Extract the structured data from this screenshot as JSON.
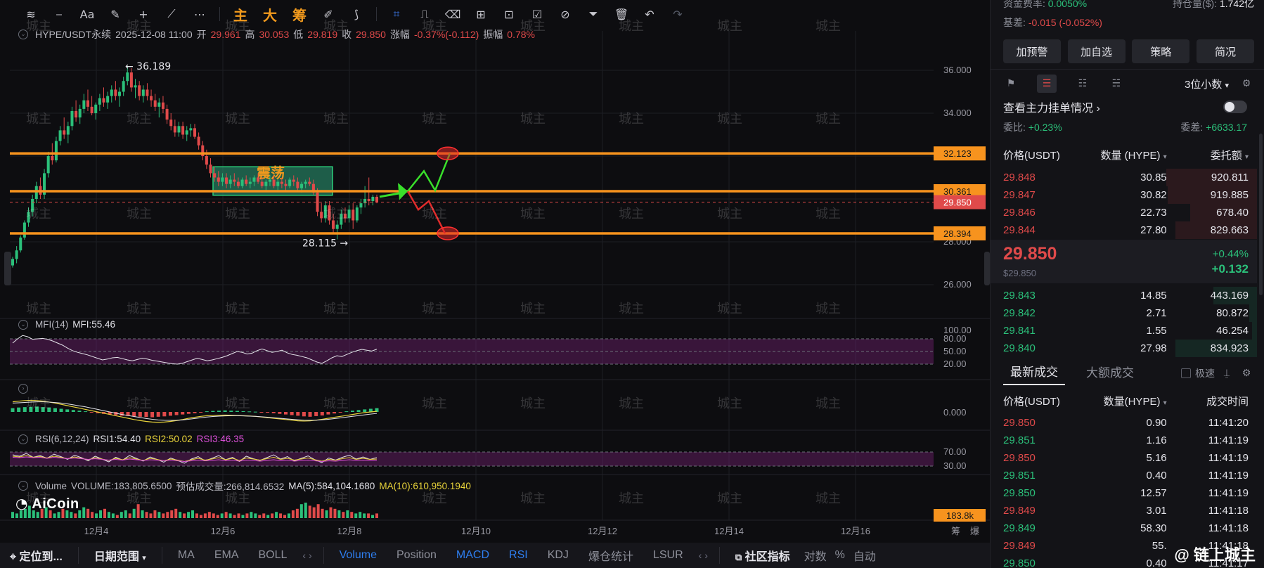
{
  "toolbar": {
    "cn_tools": [
      "主",
      "大",
      "筹"
    ]
  },
  "info": {
    "symbol": "HYPE/USDT永续",
    "datetime": "2025-12-08 11:00",
    "open_label": "开",
    "open": "29.961",
    "high_label": "高",
    "high": "30.053",
    "low_label": "低",
    "low": "29.819",
    "close_label": "收",
    "close": "29.850",
    "change_label": "涨幅",
    "change": "-0.37%(-0.112)",
    "amp_label": "振幅",
    "amp": "0.78%"
  },
  "chart_data": {
    "type": "candlestick",
    "price_axis": {
      "ticks": [
        "36.000",
        "34.000",
        "32.000",
        "30.000",
        "28.000",
        "26.000"
      ]
    },
    "x_ticks": [
      "12月4",
      "12月6",
      "12月8",
      "12月10",
      "12月12",
      "12月14",
      "12月16"
    ],
    "high_annotation": "36.189",
    "low_annotation": "28.115",
    "levels": [
      {
        "label": "32.123",
        "value": 32.123
      },
      {
        "label": "30.361",
        "value": 30.361
      },
      {
        "label": "28.394",
        "value": 28.394
      }
    ],
    "current_price": {
      "label": "29.850",
      "value": 29.85
    },
    "range_box_label": "震荡",
    "candles": [
      [
        26.9,
        27.3,
        26.8,
        27.2
      ],
      [
        27.2,
        27.8,
        27.0,
        27.6
      ],
      [
        27.6,
        28.3,
        27.5,
        28.2
      ],
      [
        28.2,
        29.0,
        28.1,
        28.9
      ],
      [
        28.9,
        29.6,
        28.7,
        29.4
      ],
      [
        29.4,
        30.2,
        29.2,
        30.0
      ],
      [
        30.0,
        30.8,
        29.8,
        30.6
      ],
      [
        30.6,
        31.0,
        30.0,
        30.2
      ],
      [
        30.2,
        31.4,
        30.0,
        31.2
      ],
      [
        31.2,
        32.2,
        31.0,
        32.0
      ],
      [
        32.0,
        32.6,
        31.6,
        31.8
      ],
      [
        31.8,
        32.9,
        31.7,
        32.7
      ],
      [
        32.7,
        33.4,
        32.5,
        33.2
      ],
      [
        33.2,
        33.8,
        32.8,
        33.0
      ],
      [
        33.0,
        33.6,
        32.6,
        33.4
      ],
      [
        33.4,
        34.3,
        33.2,
        34.1
      ],
      [
        34.1,
        34.6,
        33.6,
        33.8
      ],
      [
        33.8,
        34.4,
        33.5,
        34.2
      ],
      [
        34.2,
        34.9,
        34.0,
        34.6
      ],
      [
        34.6,
        35.1,
        34.1,
        34.3
      ],
      [
        34.3,
        34.8,
        33.9,
        34.0
      ],
      [
        34.0,
        34.5,
        33.7,
        34.4
      ],
      [
        34.4,
        34.9,
        34.1,
        34.7
      ],
      [
        34.7,
        35.2,
        34.3,
        34.5
      ],
      [
        34.5,
        35.0,
        34.2,
        34.8
      ],
      [
        34.8,
        35.3,
        34.5,
        35.1
      ],
      [
        35.1,
        35.5,
        34.6,
        34.8
      ],
      [
        34.8,
        35.2,
        34.3,
        35.0
      ],
      [
        35.0,
        35.7,
        34.8,
        35.5
      ],
      [
        35.5,
        36.189,
        35.3,
        35.9
      ],
      [
        35.9,
        36.1,
        35.0,
        35.2
      ],
      [
        35.2,
        35.6,
        34.7,
        35.3
      ],
      [
        35.3,
        35.5,
        34.6,
        34.8
      ],
      [
        34.8,
        35.3,
        34.5,
        35.1
      ],
      [
        35.1,
        35.4,
        34.6,
        34.8
      ],
      [
        34.8,
        35.1,
        34.3,
        34.6
      ],
      [
        34.6,
        34.9,
        34.1,
        34.3
      ],
      [
        34.3,
        34.7,
        33.8,
        34.5
      ],
      [
        34.5,
        34.8,
        34.0,
        34.2
      ],
      [
        34.2,
        34.4,
        33.5,
        33.7
      ],
      [
        33.7,
        34.0,
        33.2,
        33.4
      ],
      [
        33.4,
        33.7,
        32.9,
        33.1
      ],
      [
        33.1,
        33.6,
        32.9,
        33.4
      ],
      [
        33.4,
        33.6,
        32.8,
        33.0
      ],
      [
        33.0,
        33.4,
        32.7,
        33.2
      ],
      [
        33.2,
        33.5,
        32.9,
        33.3
      ],
      [
        33.3,
        33.5,
        32.8,
        32.9
      ],
      [
        32.9,
        33.1,
        32.3,
        32.5
      ],
      [
        32.5,
        32.7,
        31.8,
        32.0
      ],
      [
        32.0,
        32.3,
        31.4,
        31.6
      ],
      [
        31.6,
        31.9,
        31.0,
        31.2
      ],
      [
        31.2,
        31.5,
        30.8,
        31.0
      ],
      [
        31.0,
        31.3,
        30.6,
        30.8
      ],
      [
        30.8,
        31.2,
        30.6,
        31.0
      ],
      [
        31.0,
        31.2,
        30.5,
        30.7
      ],
      [
        30.7,
        31.1,
        30.5,
        30.9
      ],
      [
        30.9,
        31.2,
        30.6,
        30.8
      ],
      [
        30.8,
        31.0,
        30.5,
        30.6
      ],
      [
        30.6,
        31.0,
        30.5,
        30.9
      ],
      [
        30.9,
        31.1,
        30.6,
        30.7
      ],
      [
        30.7,
        31.0,
        30.5,
        30.8
      ],
      [
        30.8,
        31.1,
        30.6,
        31.0
      ],
      [
        31.0,
        31.2,
        30.7,
        30.8
      ],
      [
        30.8,
        31.0,
        30.5,
        30.6
      ],
      [
        30.6,
        30.9,
        30.4,
        30.8
      ],
      [
        30.8,
        31.1,
        30.6,
        30.9
      ],
      [
        30.9,
        31.1,
        30.5,
        30.6
      ],
      [
        30.6,
        30.9,
        30.4,
        30.8
      ],
      [
        30.8,
        31.0,
        30.5,
        30.7
      ],
      [
        30.7,
        30.9,
        30.4,
        30.6
      ],
      [
        30.6,
        31.0,
        30.5,
        30.9
      ],
      [
        30.9,
        31.1,
        30.6,
        30.8
      ],
      [
        30.8,
        31.0,
        30.4,
        30.5
      ],
      [
        30.5,
        30.8,
        30.3,
        30.7
      ],
      [
        30.7,
        30.9,
        30.5,
        30.8
      ],
      [
        30.8,
        31.0,
        30.6,
        30.7
      ],
      [
        30.7,
        30.9,
        30.2,
        30.3
      ],
      [
        30.3,
        30.5,
        29.2,
        29.4
      ],
      [
        29.4,
        29.8,
        28.9,
        29.1
      ],
      [
        29.1,
        29.9,
        28.9,
        29.7
      ],
      [
        29.7,
        29.9,
        28.8,
        29.0
      ],
      [
        29.0,
        29.3,
        28.4,
        28.6
      ],
      [
        28.6,
        29.0,
        28.115,
        28.8
      ],
      [
        28.8,
        29.5,
        28.6,
        29.3
      ],
      [
        29.3,
        29.6,
        28.9,
        29.1
      ],
      [
        29.1,
        29.7,
        28.9,
        29.5
      ],
      [
        29.5,
        29.8,
        28.6,
        29.0
      ],
      [
        29.0,
        29.7,
        28.9,
        29.6
      ],
      [
        29.6,
        30.0,
        29.3,
        29.8
      ],
      [
        29.8,
        30.6,
        29.6,
        30.0
      ],
      [
        30.0,
        31.0,
        29.7,
        29.9
      ],
      [
        29.9,
        30.2,
        29.7,
        30.1
      ],
      [
        30.1,
        30.2,
        29.8,
        29.85
      ]
    ]
  },
  "mfi": {
    "title": "MFI(14)",
    "value_text": "MFI:55.46",
    "ticks": [
      "100.00",
      "80.00",
      "50.00",
      "20.00"
    ],
    "values": [
      70,
      80,
      88,
      85,
      79,
      80,
      81,
      79,
      75,
      70,
      65,
      58,
      52,
      48,
      45,
      42,
      38,
      34,
      30,
      32,
      35,
      36,
      33,
      30,
      28,
      31,
      34,
      32,
      29,
      27,
      25,
      23,
      21,
      20,
      22,
      26,
      30,
      34,
      31,
      28,
      30,
      33,
      36,
      40,
      45,
      50,
      48,
      44,
      46,
      52,
      56,
      52,
      48,
      50,
      53,
      47,
      43,
      41,
      38,
      35,
      30,
      25,
      22,
      28,
      35,
      40,
      38,
      43,
      48,
      52,
      55,
      53,
      51,
      55.46
    ]
  },
  "macd": {
    "ticks": [
      "0.000"
    ],
    "hist": [
      0.3,
      0.35,
      0.38,
      0.4,
      0.42,
      0.38,
      0.35,
      0.3,
      0.25,
      0.2,
      0.15,
      0.1,
      0.05,
      -0.05,
      -0.1,
      -0.15,
      -0.2,
      -0.25,
      -0.3,
      -0.32,
      -0.35,
      -0.38,
      -0.4,
      -0.42,
      -0.38,
      -0.35,
      -0.3,
      -0.25,
      -0.2,
      -0.15,
      -0.1,
      -0.05,
      0.05,
      0.08,
      0.1,
      0.12,
      0.1,
      0.08,
      0.06,
      0.04,
      0.02,
      -0.02,
      -0.05,
      -0.1,
      -0.15,
      -0.2,
      -0.25,
      -0.3,
      -0.35,
      -0.38,
      -0.33,
      -0.28,
      -0.2,
      -0.12,
      -0.05,
      0.05,
      0.1,
      0.15,
      0.2,
      0.25,
      0.3
    ],
    "dif": [
      0.8,
      0.85,
      0.9,
      0.92,
      0.9,
      0.85,
      0.78,
      0.7,
      0.6,
      0.5,
      0.4,
      0.3,
      0.2,
      0.1,
      0.0,
      -0.1,
      -0.2,
      -0.3,
      -0.4,
      -0.5,
      -0.6,
      -0.68,
      -0.75,
      -0.8,
      -0.82,
      -0.8,
      -0.75,
      -0.68,
      -0.6,
      -0.5,
      -0.42,
      -0.35,
      -0.3,
      -0.28,
      -0.26,
      -0.25,
      -0.26,
      -0.28,
      -0.3,
      -0.32,
      -0.35,
      -0.4,
      -0.45,
      -0.5,
      -0.55,
      -0.6,
      -0.65,
      -0.7,
      -0.72,
      -0.7,
      -0.65,
      -0.58,
      -0.5,
      -0.42,
      -0.35,
      -0.28,
      -0.2,
      -0.12,
      -0.05,
      0.0,
      0.05
    ],
    "dea": [
      0.7,
      0.72,
      0.75,
      0.78,
      0.8,
      0.8,
      0.78,
      0.74,
      0.7,
      0.64,
      0.56,
      0.48,
      0.4,
      0.3,
      0.2,
      0.1,
      0.0,
      -0.1,
      -0.2,
      -0.28,
      -0.36,
      -0.44,
      -0.52,
      -0.58,
      -0.63,
      -0.66,
      -0.67,
      -0.66,
      -0.63,
      -0.58,
      -0.52,
      -0.46,
      -0.4,
      -0.36,
      -0.33,
      -0.31,
      -0.3,
      -0.3,
      -0.31,
      -0.33,
      -0.35,
      -0.38,
      -0.42,
      -0.46,
      -0.5,
      -0.54,
      -0.58,
      -0.62,
      -0.65,
      -0.66,
      -0.65,
      -0.62,
      -0.58,
      -0.53,
      -0.47,
      -0.41,
      -0.35,
      -0.29,
      -0.23,
      -0.17,
      -0.12
    ]
  },
  "rsi": {
    "title": "RSI(6,12,24)",
    "rsi1": "RSI1:54.40",
    "rsi2": "RSI2:50.02",
    "rsi3": "RSI3:46.35",
    "ticks": [
      "70.00",
      "30.00"
    ],
    "line1": [
      62,
      58,
      66,
      55,
      60,
      52,
      64,
      57,
      49,
      61,
      54,
      45,
      58,
      50,
      42,
      55,
      47,
      60,
      52,
      44,
      56,
      49,
      41,
      53,
      46,
      38,
      50,
      57,
      45,
      52,
      60,
      48,
      55,
      43,
      58,
      51,
      46,
      54,
      62,
      50,
      57,
      45,
      52,
      59,
      48,
      40,
      53,
      47,
      55,
      61,
      50,
      56,
      49,
      54.4
    ],
    "line2": [
      58,
      56,
      60,
      55,
      57,
      53,
      58,
      55,
      51,
      56,
      52,
      48,
      54,
      50,
      46,
      52,
      48,
      54,
      50,
      46,
      52,
      49,
      45,
      50,
      47,
      43,
      48,
      52,
      47,
      50,
      54,
      48,
      52,
      46,
      53,
      50,
      47,
      51,
      55,
      49,
      52,
      47,
      50,
      53,
      48,
      44,
      49,
      47,
      51,
      54,
      49,
      52,
      49,
      50.02
    ],
    "line3": [
      55,
      54,
      56,
      54,
      55,
      52,
      55,
      53,
      51,
      53,
      51,
      49,
      51,
      49,
      47,
      49,
      47,
      50,
      48,
      46,
      48,
      47,
      45,
      47,
      45,
      43,
      45,
      47,
      45,
      46,
      48,
      45,
      47,
      44,
      47,
      46,
      44,
      46,
      48,
      45,
      47,
      44,
      46,
      47,
      45,
      43,
      45,
      44,
      46,
      48,
      46,
      47,
      46,
      46.35
    ]
  },
  "volume": {
    "title": "Volume",
    "vol_text": "VOLUME:183,805.6500",
    "est_text": "预估成交量:266,814.6532",
    "ma5": "MA(5):584,104.1680",
    "ma10": "MA(10):610,950.1940",
    "last_label": "183.8k",
    "bars": [
      0.4,
      0.3,
      0.5,
      0.6,
      0.8,
      0.5,
      0.4,
      0.6,
      0.7,
      0.5,
      0.3,
      0.4,
      0.6,
      0.5,
      0.4,
      0.3,
      0.5,
      0.7,
      0.6,
      0.4,
      0.3,
      0.5,
      0.6,
      0.4,
      0.3,
      0.2,
      0.4,
      0.5,
      0.3,
      0.6,
      0.9,
      0.5,
      0.4,
      0.3,
      0.5,
      0.4,
      0.3,
      0.4,
      0.5,
      0.6,
      0.4,
      0.3,
      0.4,
      0.5,
      0.3,
      0.2,
      0.3,
      0.4,
      0.3,
      0.2,
      0.3,
      0.4,
      0.3,
      0.2,
      0.3,
      0.2,
      0.3,
      0.4,
      0.3,
      0.2,
      0.3,
      0.2,
      0.3,
      0.4,
      0.3,
      0.2,
      0.3,
      0.5,
      0.6,
      0.9,
      1.0,
      0.8,
      0.7,
      0.9,
      0.6,
      0.5,
      0.7,
      0.6,
      0.5,
      0.4,
      0.5,
      0.4,
      0.3,
      0.4,
      0.3,
      0.3,
      0.2,
      0.3
    ]
  },
  "logo": "AiCoin",
  "axis_corner": [
    "筹",
    "爆"
  ],
  "watermark": "城主",
  "bottom_bar": {
    "locate": "定位到...",
    "range": "日期范围",
    "ma": "MA",
    "ema": "EMA",
    "boll": "BOLL",
    "volume": "Volume",
    "position": "Position",
    "macd": "MACD",
    "rsi": "RSI",
    "kdj": "KDJ",
    "liq": "爆仓统计",
    "lsur": "LSUR",
    "community": "社区指标",
    "log": "对数",
    "pct": "%",
    "auto": "自动"
  },
  "right": {
    "funding_label": "资金费率:",
    "funding_value": "0.0050%",
    "oi_label": "持仓量($):",
    "oi_value": "1.742亿",
    "basis_label": "基差:",
    "basis_value": "-0.015 (-0.052%)",
    "buttons": [
      "加预警",
      "加自选",
      "策略",
      "简况"
    ],
    "decimals": "3位小数",
    "orders_link": "查看主力挂单情况",
    "ratio_label": "委比:",
    "ratio_value": "+0.23%",
    "diff_label": "委差:",
    "diff_value": "+6633.17",
    "ob_headers": [
      "价格(USDT)",
      "数量 (HYPE)",
      "委托额"
    ],
    "asks": [
      [
        "29.848",
        "30.85",
        "920.811",
        0.92
      ],
      [
        "29.847",
        "30.82",
        "919.885",
        0.91
      ],
      [
        "29.846",
        "22.73",
        "678.40",
        0.68
      ],
      [
        "29.844",
        "27.80",
        "829.663",
        0.83
      ]
    ],
    "last_price": "29.850",
    "last_usd": "$29.850",
    "chg_pct": "+0.44%",
    "chg_abs": "+0.132",
    "bids": [
      [
        "29.843",
        "14.85",
        "443.169",
        0.44
      ],
      [
        "29.842",
        "2.71",
        "80.872",
        0.08
      ],
      [
        "29.841",
        "1.55",
        "46.254",
        0.05
      ],
      [
        "29.840",
        "27.98",
        "834.923",
        0.83
      ]
    ],
    "tab_latest": "最新成交",
    "tab_large": "大额成交",
    "speed_label": "极速",
    "tr_headers": [
      "价格(USDT)",
      "数量(HYPE)",
      "成交时间"
    ],
    "trades": [
      [
        "29.850",
        "0.90",
        "11:41:20",
        "red"
      ],
      [
        "29.851",
        "1.16",
        "11:41:19",
        "green"
      ],
      [
        "29.850",
        "5.16",
        "11:41:19",
        "red"
      ],
      [
        "29.851",
        "0.40",
        "11:41:19",
        "green"
      ],
      [
        "29.850",
        "12.57",
        "11:41:19",
        "green"
      ],
      [
        "29.849",
        "3.01",
        "11:41:18",
        "red"
      ],
      [
        "29.849",
        "58.30",
        "11:41:18",
        "green"
      ],
      [
        "29.849",
        "55.",
        "11:41:18",
        "red"
      ],
      [
        "29.850",
        "0.40",
        "11:41:17",
        "green"
      ]
    ],
    "signature": "@ 链上城主"
  }
}
